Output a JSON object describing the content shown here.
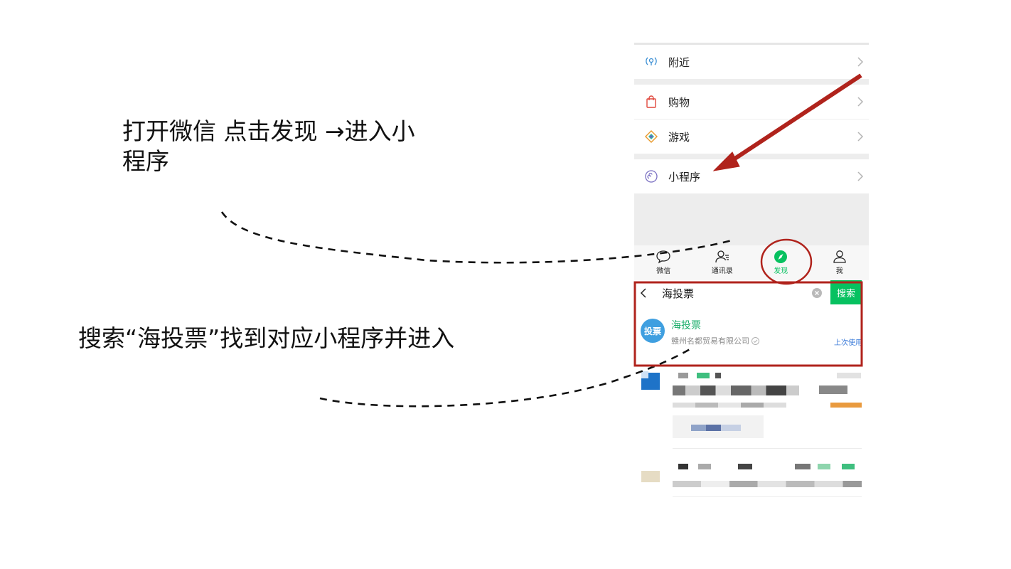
{
  "instructions": {
    "step1": "打开微信 点击发现 →进入小程序",
    "step2": "搜索“海投票”找到对应小程序并进入"
  },
  "discover_menu": {
    "items": [
      {
        "label": "附近",
        "icon": "nearby-icon"
      },
      {
        "label": "购物",
        "icon": "shopping-bag-icon"
      },
      {
        "label": "游戏",
        "icon": "game-icon"
      },
      {
        "label": "小程序",
        "icon": "mini-program-icon"
      }
    ]
  },
  "tabbar": {
    "tabs": [
      {
        "label": "微信",
        "icon": "chat-icon"
      },
      {
        "label": "通讯录",
        "icon": "contacts-icon"
      },
      {
        "label": "发现",
        "icon": "compass-icon",
        "active": true
      },
      {
        "label": "我",
        "icon": "profile-icon"
      }
    ]
  },
  "search": {
    "query": "海投票",
    "button_label": "搜索"
  },
  "result": {
    "logo_text": "投票",
    "name": "海投票",
    "company": "赣州名都贸易有限公司",
    "last_used": "上次使用"
  },
  "colors": {
    "wechat_green": "#07c160",
    "annotation_red": "#b0231c",
    "result_name_green": "#1aad6a",
    "logo_blue": "#3f9fe0"
  }
}
